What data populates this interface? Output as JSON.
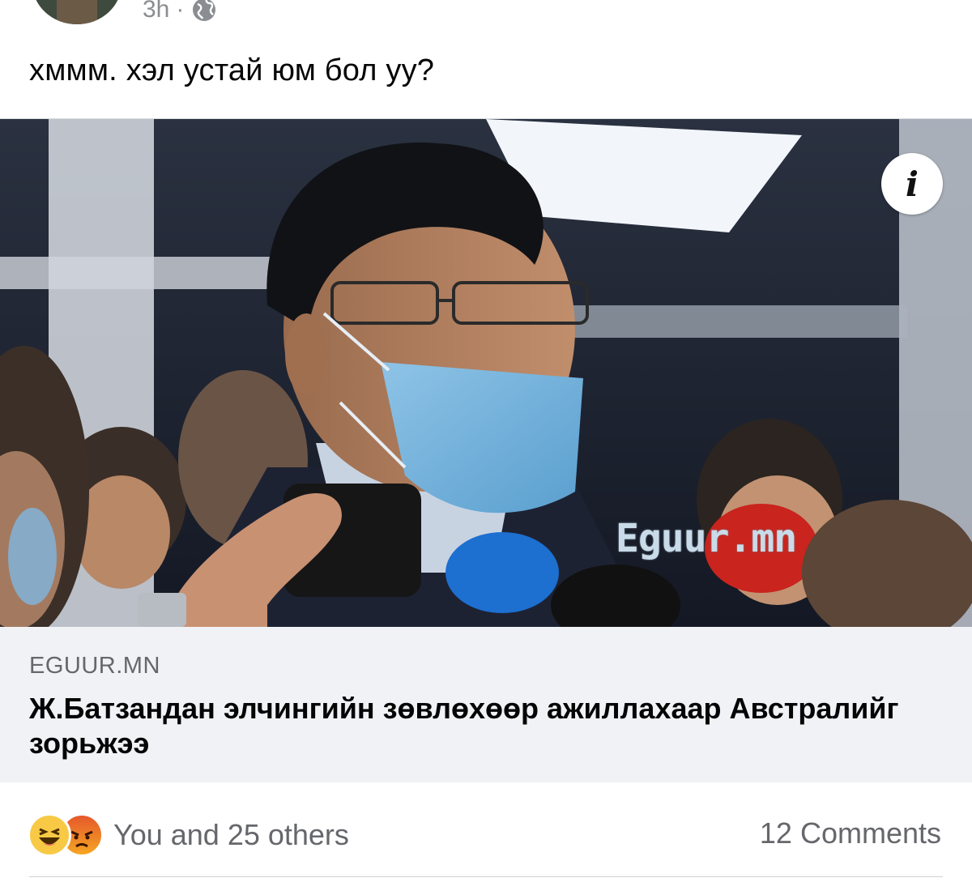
{
  "post": {
    "timestamp": "3h",
    "separator": "·",
    "audience_icon": "globe-icon",
    "text": "хммм. хэл устай юм бол уу?"
  },
  "link_preview": {
    "image_watermark": "Eguur.mn",
    "info_icon": "info-icon",
    "info_glyph": "i",
    "domain": "EGUUR.MN",
    "headline": "Ж.Батзандан элчингийн зөвлөхөөр ажиллахаар Австралийг зорьжээ"
  },
  "engagement": {
    "reaction_icons": [
      "haha-reaction-icon",
      "angry-reaction-icon"
    ],
    "reactions_text": "You and 25 others",
    "comments_text": "12 Comments"
  },
  "colors": {
    "background": "#ffffff",
    "link_card_bg": "#f0f2f5",
    "secondary_text": "#65676b",
    "primary_text": "#050505"
  }
}
